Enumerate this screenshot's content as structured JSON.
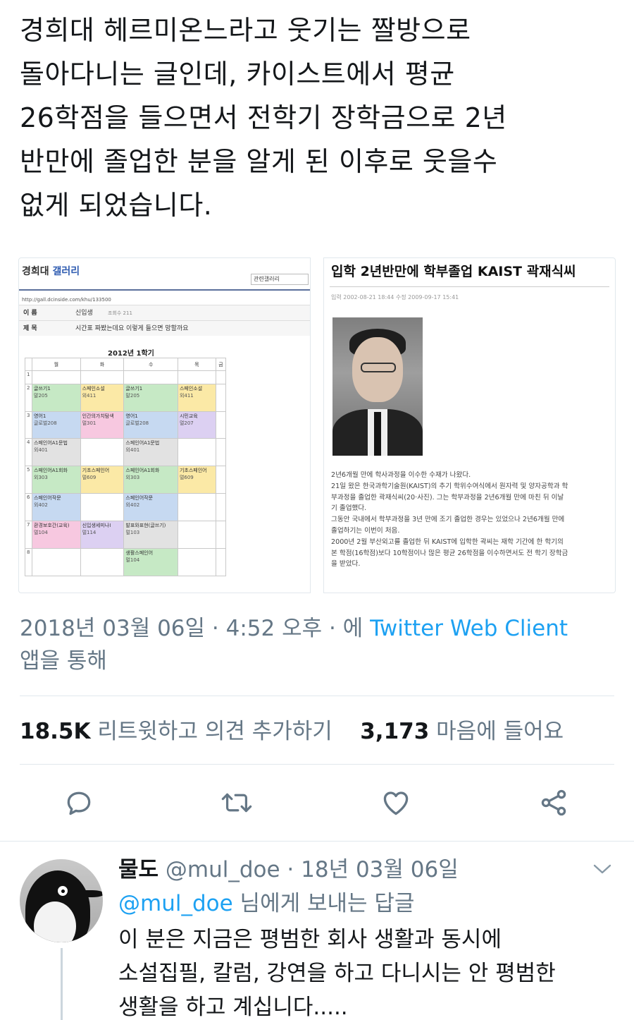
{
  "tweet": {
    "lines": [
      "경희대 헤르미온느라고 웃기는 짤방으로",
      "돌아다니는 글인데, 카이스트에서 평균",
      "26학점을 들으면서 전학기 장학금으로 2년",
      "반만에 졸업한 분을 알게 된 이후로 웃을수",
      "없게 되었습니다."
    ]
  },
  "media_left": {
    "gallery_title": "경희대",
    "gallery_title_blue": "갤러리",
    "related_button": "관련갤러리",
    "url": "http://gall.dcinside.com/khu/133500",
    "name_label": "이 름",
    "name_value": "신입생",
    "views_label": "조회수 211",
    "subject_label": "제 목",
    "subject_value": "시간표 짜봤는데요 이렇게 들으면 망할까요",
    "timetable_title": "2012년 1학기",
    "days": [
      "월",
      "화",
      "수",
      "목",
      "금"
    ],
    "rows": [
      {
        "n": "1",
        "cells": [
          [
            "",
            ""
          ],
          [
            "",
            ""
          ],
          [
            "",
            ""
          ],
          [
            "",
            ""
          ],
          [
            "",
            ""
          ]
        ]
      },
      {
        "n": "2",
        "cells": [
          [
            "글쓰기1",
            "말205"
          ],
          [
            "스페인소설",
            "외411"
          ],
          [
            "글쓰기1",
            "말205"
          ],
          [
            "스페인소설",
            "외411"
          ],
          [
            "",
            ""
          ]
        ]
      },
      {
        "n": "3",
        "cells": [
          [
            "영어1",
            "글로벌208"
          ],
          [
            "인간의가치탐색",
            "멀301"
          ],
          [
            "영어1",
            "글로벌208"
          ],
          [
            "시민교육",
            "멀207"
          ],
          [
            "",
            ""
          ]
        ]
      },
      {
        "n": "4",
        "cells": [
          [
            "스페인어A1문법",
            "외401"
          ],
          [
            "",
            ""
          ],
          [
            "스페인어A1문법",
            "외401"
          ],
          [
            "",
            ""
          ],
          [
            "",
            ""
          ]
        ]
      },
      {
        "n": "5",
        "cells": [
          [
            "스페인어A1회화",
            "외303"
          ],
          [
            "기초스페인어",
            "멀609"
          ],
          [
            "스페인어A1회화",
            "외303"
          ],
          [
            "기초스페인어",
            "멀609"
          ],
          [
            "",
            ""
          ]
        ]
      },
      {
        "n": "6",
        "cells": [
          [
            "스페인어작문",
            "외402"
          ],
          [
            "",
            ""
          ],
          [
            "스페인어작문",
            "외402"
          ],
          [
            "",
            ""
          ],
          [
            "",
            ""
          ]
        ]
      },
      {
        "n": "7",
        "cells": [
          [
            "환경보호간(교육)",
            "멀104"
          ],
          [
            "신입생세미나I",
            "멀114"
          ],
          [
            "발표와표현(글쓰기)",
            "멀103"
          ],
          [
            "",
            ""
          ],
          [
            "",
            ""
          ]
        ]
      },
      {
        "n": "8",
        "cells": [
          [
            "",
            ""
          ],
          [
            "",
            ""
          ],
          [
            "생활스페인어",
            "멀104"
          ],
          [
            "",
            ""
          ],
          [
            "",
            ""
          ]
        ]
      }
    ]
  },
  "media_right": {
    "title": "입학 2년반만에 학부졸업 KAIST 곽재식씨",
    "meta": "입력 2002-08-21 18:44   수정 2009-09-17 15:41",
    "body_lines": [
      "2년6개월 만에 학사과정을 이수한 수재가 나왔다.",
      "21일 왔은 한국과학기술원(KAIST)의 추기 학위수여식에서 원자력 및 양자공학과 학",
      "부과정을 졸업한 곽재식씨(20·사진). 그는 학부과정을 2년6개월 만에 마친 뒤 이날",
      "기 졸업했다.",
      "그동안 국내에서 학부과정을 3년 만에 조기 졸업한 경우는 있었으나 2년6개월 만에",
      "졸업하기는 이번이 처음.",
      "2000년 2월 부산외고를 졸업한 뒤 KAIST에 입학한 곽씨는 재학 기간에 한 학기의",
      "본 학점(16학점)보다 10학점이나 많은 평균 26학점을 이수하면서도 전 학기 장학금",
      "을 받았다."
    ]
  },
  "timestamp": {
    "prefix": "2018년 03월 06일 · 4:52 오후 · 에",
    "client": "Twitter Web Client",
    "suffix": "앱을 통해"
  },
  "stats": {
    "retweets": "18.5K",
    "retweets_label": "리트윗하고 의견 추가하기",
    "likes": "3,173",
    "likes_label": "마음에 들어요"
  },
  "actions": {
    "icons": [
      "reply-icon",
      "retweet-icon",
      "like-icon",
      "share-icon"
    ]
  },
  "reply": {
    "name": "물도",
    "handle": "@mul_doe · 18년 03월 06일",
    "replying_mention": "@mul_doe",
    "replying_suffix": "님에게 보내는 답글",
    "text_lines": [
      "이 분은 지금은 평범한 회사 생활과 동시에",
      "소설집필, 칼럼, 강연을 하고 다니시는 안 평범한",
      "생활을 하고 계십니다....."
    ]
  },
  "colors": {
    "link": "#1da1f2",
    "secondary_text": "#657786",
    "primary_text": "#14171a",
    "divider": "#e1e8ed"
  }
}
